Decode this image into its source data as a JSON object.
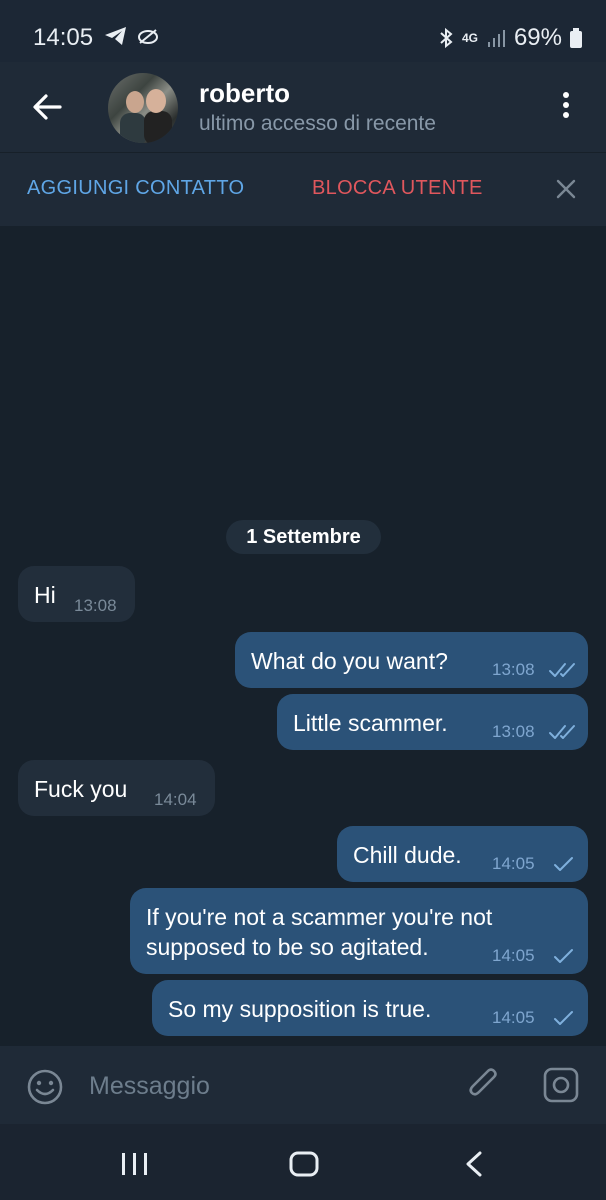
{
  "status": {
    "time": "14:05",
    "network": "4G",
    "battery": "69%"
  },
  "header": {
    "name": "roberto",
    "last_seen": "ultimo accesso di recente"
  },
  "actions": {
    "add_contact": "AGGIUNGI CONTATTO",
    "block_user": "BLOCCA UTENTE"
  },
  "date_separator": "1 Settembre",
  "messages": [
    {
      "dir": "in",
      "text": "Hi",
      "time": "13:08"
    },
    {
      "dir": "out",
      "text": "What do you want?",
      "time": "13:08",
      "status": "read"
    },
    {
      "dir": "out",
      "text": "Little scammer.",
      "time": "13:08",
      "status": "read"
    },
    {
      "dir": "in",
      "text": "Fuck you",
      "time": "14:04"
    },
    {
      "dir": "out",
      "text": "Chill dude.",
      "time": "14:05",
      "status": "sent"
    },
    {
      "dir": "out",
      "text_lines": [
        "If you're not a scammer you're not",
        "supposed to be so agitated."
      ],
      "time": "14:05",
      "status": "sent"
    },
    {
      "dir": "out",
      "text": "So my supposition is true.",
      "time": "14:05",
      "status": "sent"
    }
  ],
  "input": {
    "placeholder": "Messaggio"
  },
  "colors": {
    "incoming": "#222e3b",
    "outgoing": "#2b5278",
    "accent": "#5fa6e6",
    "danger": "#e0575d"
  }
}
